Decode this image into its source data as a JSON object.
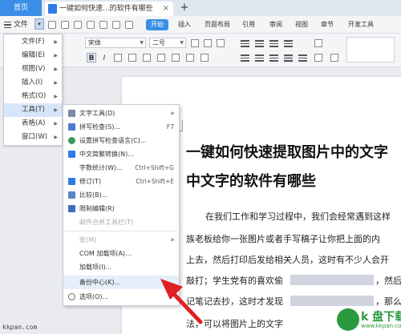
{
  "tabs": {
    "home": "首页",
    "document": "一键如何快速...的软件有哪些",
    "close": "×",
    "add": "+"
  },
  "menubar": {
    "file": "文件",
    "start": "开始",
    "tabs": [
      "插入",
      "页面布局",
      "引用",
      "审阅",
      "视图",
      "章节",
      "开发工具"
    ]
  },
  "toolbar": {
    "font_name": "宋体",
    "font_size": "二号",
    "bold": "B",
    "italic": "I"
  },
  "file_menu": {
    "items": [
      {
        "label": "文件(F)",
        "has_sub": true
      },
      {
        "label": "编辑(E)",
        "has_sub": true
      },
      {
        "label": "视图(V)",
        "has_sub": true
      },
      {
        "label": "插入(I)",
        "has_sub": true
      },
      {
        "label": "格式(O)",
        "has_sub": true
      },
      {
        "label": "工具(T)",
        "has_sub": true,
        "active": true
      },
      {
        "label": "表格(A)",
        "has_sub": true
      },
      {
        "label": "窗口(W)",
        "has_sub": true
      }
    ]
  },
  "tools_menu": {
    "items": [
      {
        "label": "文字工具(D)",
        "shortcut": "",
        "sub": true,
        "icon": "text-tool-icon",
        "disabled": false
      },
      {
        "label": "拼写检查(S)...",
        "shortcut": "F7",
        "icon": "spellcheck-icon",
        "disabled": false
      },
      {
        "label": "设置拼写检查语言(C)...",
        "shortcut": "",
        "icon": "language-icon",
        "disabled": false
      },
      {
        "label": "中文简繁转换(N)...",
        "shortcut": "",
        "icon": "convert-icon",
        "disabled": false
      },
      {
        "label": "字数统计(W)...",
        "shortcut": "Ctrl+Shift+G",
        "icon": "",
        "disabled": false
      },
      {
        "label": "修订(T)",
        "shortcut": "Ctrl+Shift+E",
        "icon": "revision-icon",
        "disabled": false
      },
      {
        "label": "比较(B)...",
        "shortcut": "",
        "icon": "compare-icon",
        "disabled": false
      },
      {
        "label": "限制编辑(R)",
        "shortcut": "",
        "icon": "restrict-icon",
        "disabled": false
      },
      {
        "label": "邮件合并工具栏(T)",
        "shortcut": "",
        "icon": "",
        "disabled": true
      },
      {
        "label": "宏(M)",
        "shortcut": "",
        "sub": true,
        "icon": "",
        "disabled": true
      },
      {
        "label": "COM 加载项(A)...",
        "shortcut": "",
        "icon": "",
        "disabled": false
      },
      {
        "label": "加载项(I)...",
        "shortcut": "",
        "icon": "",
        "disabled": false
      },
      {
        "label": "备份中心(K)...",
        "shortcut": "",
        "icon": "",
        "disabled": false,
        "highlight": true
      },
      {
        "label": "选项(O)...",
        "shortcut": "",
        "icon": "settings-icon",
        "disabled": false
      }
    ]
  },
  "document": {
    "title_line1": "一键如何快速提取图片中的文字",
    "title_line2": "中文字的软件有哪些",
    "body": [
      "在我们工作和学习过程中，我们会经常遇到这样",
      "族老板给你一张图片或者手写稿子让你把上面的内",
      "上去，然后打印后发给相关人员，这时有不少人会开",
      "敲打；学生党有的喜欢偷",
      "记笔记去抄，这时才发现",
      "法，可以将图片上的文字"
    ],
    "body_after": [
      "",
      "",
      "",
      "，然后找学",
      "，那么有"
    ]
  },
  "watermarks": {
    "left": "kkpan.com",
    "right_title": "k 盘下载",
    "right_url": "www.kkpan.com"
  },
  "colors": {
    "accent": "#3a8ee6",
    "arrow": "#e02020",
    "logo": "#2b9a3e"
  }
}
